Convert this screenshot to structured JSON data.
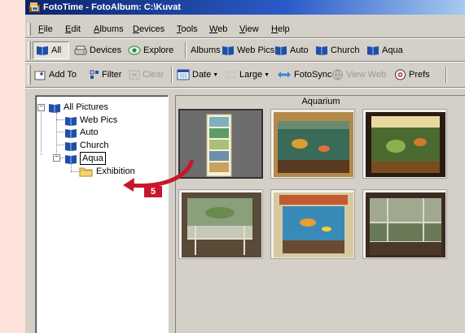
{
  "window": {
    "title": "FotoTime - FotoAlbum:  C:\\Kuvat"
  },
  "menu": [
    {
      "pre": "",
      "u": "F",
      "post": "ile"
    },
    {
      "pre": "",
      "u": "E",
      "post": "dit"
    },
    {
      "pre": "",
      "u": "A",
      "post": "lbums"
    },
    {
      "pre": "",
      "u": "D",
      "post": "evices"
    },
    {
      "pre": "",
      "u": "T",
      "post": "ools"
    },
    {
      "pre": "",
      "u": "W",
      "post": "eb"
    },
    {
      "pre": "",
      "u": "V",
      "post": "iew"
    },
    {
      "pre": "",
      "u": "H",
      "post": "elp"
    }
  ],
  "toolbar1": {
    "all": "All",
    "devices": "Devices",
    "explore": "Explore",
    "albums": "Albums",
    "web_pics": "Web Pics",
    "auto": "Auto",
    "church": "Church",
    "aqua": "Aqua"
  },
  "toolbar2": {
    "add_to": "Add To",
    "filter": "Filter",
    "clear": "Clear",
    "date": "Date",
    "large": "Large",
    "fotosync": "FotoSync",
    "view_web": "View Web",
    "prefs": "Prefs"
  },
  "tree": {
    "root": "All Pictures",
    "items": [
      "Web Pics",
      "Auto",
      "Church",
      "Aqua"
    ],
    "child": "Exhibition"
  },
  "panel": {
    "header": "Aquarium"
  },
  "callout": {
    "step": "5"
  },
  "colors": {
    "accent_red": "#c7172b",
    "title_blue": "#0a246a",
    "face": "#d4d0c8",
    "background": "#fde3dc"
  }
}
